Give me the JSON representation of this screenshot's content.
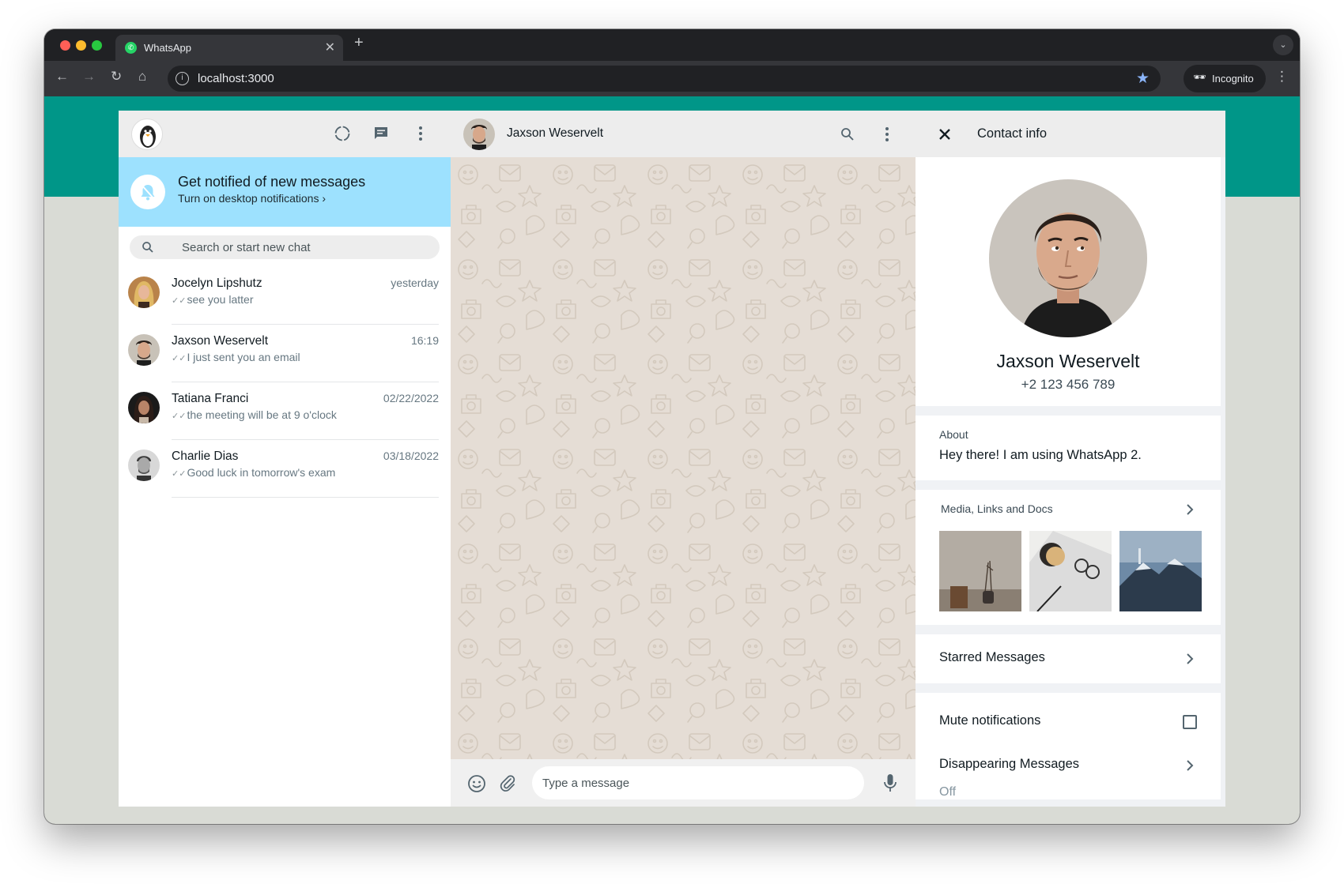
{
  "browser": {
    "tab_title": "WhatsApp",
    "tab_close": "✕",
    "new_tab": "+",
    "url": "localhost:3000",
    "incognito_label": "Incognito",
    "icons": [
      "back-arrow-icon",
      "forward-arrow-icon",
      "reload-icon",
      "home-icon",
      "site-info-icon",
      "bookmark-star-icon",
      "incognito-icon",
      "more-vertical-icon"
    ]
  },
  "colors": {
    "teal_band": "#009688",
    "notification_banner": "#9de1fe",
    "chat_background": "#e5ddd5",
    "panel_header": "#ededed"
  },
  "sidebar": {
    "notification": {
      "title": "Get notified of new messages",
      "subtitle": "Turn on desktop notifications ›"
    },
    "search": {
      "placeholder": "Search or start new chat"
    },
    "chats": [
      {
        "name": "Jocelyn Lipshutz",
        "time": "yesterday",
        "ticks": "✓✓",
        "preview": "see you latter",
        "avatar": "woman-blonde"
      },
      {
        "name": "Jaxson Weservelt",
        "time": "16:19",
        "ticks": "✓✓",
        "preview": "I just sent you an email",
        "avatar": "man-dark-hair"
      },
      {
        "name": "Tatiana Franci",
        "time": "02/22/2022",
        "ticks": "✓✓",
        "preview": "the meeting will be at 9 o'clock",
        "avatar": "woman-dark-hair"
      },
      {
        "name": "Charlie Dias",
        "time": "03/18/2022",
        "ticks": "✓✓",
        "preview": "Good luck in tomorrow's exam",
        "avatar": "man-bw"
      }
    ]
  },
  "conversation": {
    "contact_name": "Jaxson Weservelt",
    "composer_placeholder": "Type a message"
  },
  "contact_info": {
    "title": "Contact info",
    "name": "Jaxson Weservelt",
    "phone": "+2 123 456 789",
    "about_label": "About",
    "about_text": "Hey there! I am using WhatsApp 2.",
    "media_label": "Media, Links and Docs",
    "starred_label": "Starred Messages",
    "mute_label": "Mute notifications",
    "mute_checked": false,
    "disappearing_label": "Disappearing Messages",
    "disappearing_value": "Off"
  }
}
